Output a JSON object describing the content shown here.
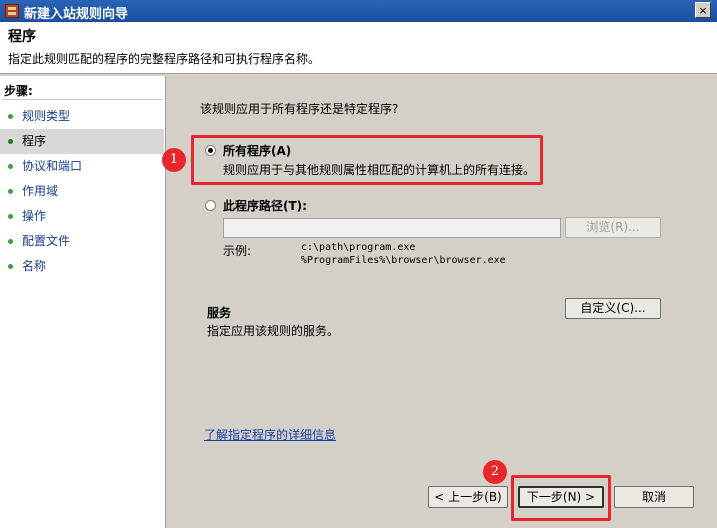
{
  "window": {
    "title": "新建入站规则向导",
    "close_label": "×"
  },
  "header": {
    "title": "程序",
    "subtitle": "指定此规则匹配的程序的完整程序路径和可执行程序名称。"
  },
  "steps": {
    "title": "步骤:",
    "items": [
      {
        "label": "规则类型"
      },
      {
        "label": "程序"
      },
      {
        "label": "协议和端口"
      },
      {
        "label": "作用域"
      },
      {
        "label": "操作"
      },
      {
        "label": "配置文件"
      },
      {
        "label": "名称"
      }
    ]
  },
  "main": {
    "question": "该规则应用于所有程序还是特定程序?",
    "all_programs": {
      "label": "所有程序(A)",
      "description": "规则应用于与其他规则属性相匹配的计算机上的所有连接。"
    },
    "this_program": {
      "label": "此程序路径(T):",
      "path_value": "",
      "browse_label": "浏览(R)..."
    },
    "example_label": "示例:",
    "example_paths": [
      "c:\\path\\program.exe",
      "%ProgramFiles%\\browser\\browser.exe"
    ],
    "services": {
      "title": "服务",
      "description": "指定应用该规则的服务。",
      "customize_label": "自定义(C)..."
    },
    "learn_more": "了解指定程序的详细信息"
  },
  "annotations": {
    "badge1": "1",
    "badge2": "2",
    "color": "#e8262c"
  },
  "footer": {
    "back_label": "< 上一步(B)",
    "next_label": "下一步(N) >",
    "cancel_label": "取消"
  }
}
